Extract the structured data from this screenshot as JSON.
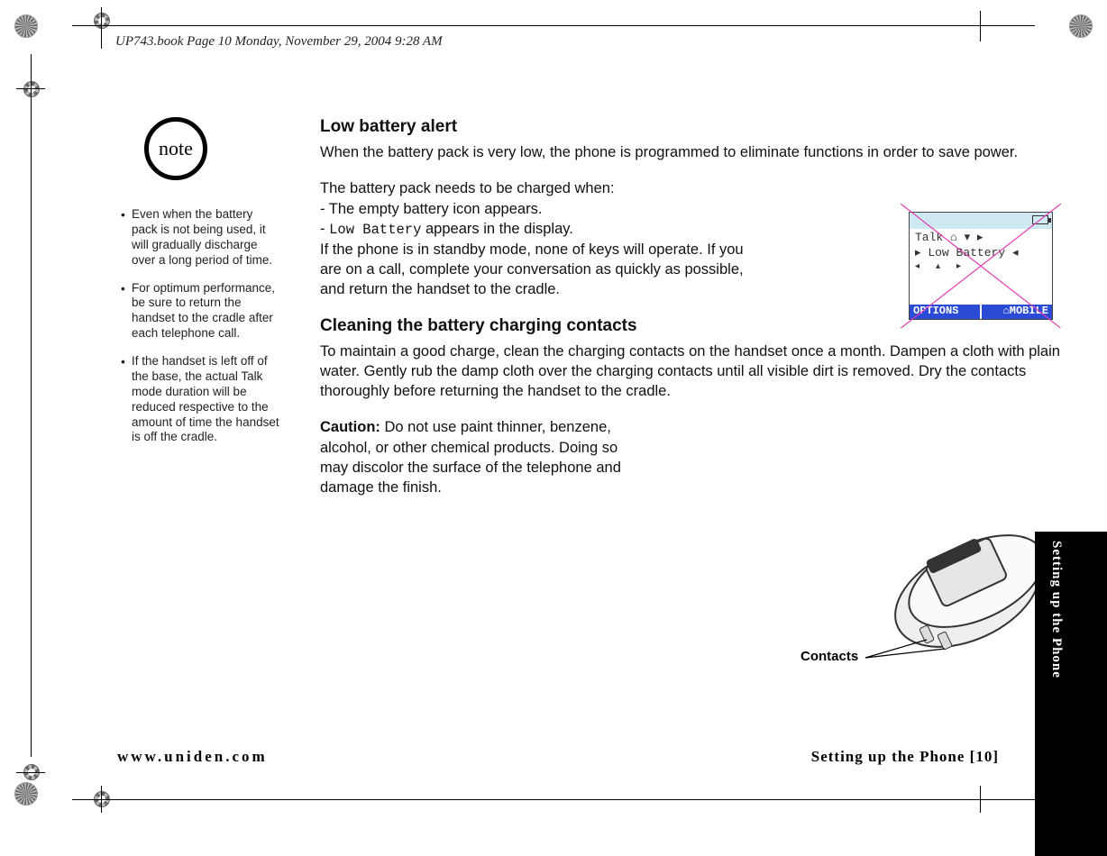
{
  "book_header": "UP743.book  Page 10  Monday, November 29, 2004  9:28 AM",
  "note": {
    "badge": "note",
    "items": [
      "Even when the battery pack is not being used, it will gradually discharge over a long period of time.",
      "For optimum performance, be sure to return the handset to the cradle after each telephone call.",
      "If the handset is left off of the base, the actual Talk mode duration will be reduced respective to the amount of time the handset is off the cradle."
    ]
  },
  "section1": {
    "heading": "Low battery alert",
    "p1": "When the battery pack is very low, the phone is programmed to eliminate functions in order to save power.",
    "p2_intro": "The battery pack needs to be charged when:",
    "p2_l1": "- The empty battery icon appears.",
    "p2_l2a": "- ",
    "p2_l2_code": "Low Battery",
    "p2_l2b": " appears in the display.",
    "p2_tail": "If the phone is in standby mode, none of keys will operate. If you are on a call, complete your conversation as quickly as possible, and return the handset to the cradle."
  },
  "section2": {
    "heading": "Cleaning the battery charging contacts",
    "p1": "To maintain a good charge, clean the charging contacts on the handset once a month. Dampen a cloth with plain water. Gently rub the damp cloth over the charging contacts until all visible dirt is removed. Dry the contacts thoroughly before returning the handset to the cradle.",
    "caution_label": "Caution:",
    "caution_body": " Do not use paint thinner, benzene, alcohol, or other chemical products. Doing so may discolor the surface of the telephone and damage the finish."
  },
  "lcd": {
    "line1": "Talk ⌂ ▾   ▸",
    "line2": " ▸ Low Battery ◂",
    "line3": "  ◂    ▴    ▸",
    "soft_left": "OPTIONS",
    "soft_right": "⌂MOBILE"
  },
  "phone_figure": {
    "label": "Contacts"
  },
  "footer": {
    "url": "www.uniden.com",
    "section": "Setting up the Phone [10]"
  },
  "side_tab": "Setting up the Phone"
}
